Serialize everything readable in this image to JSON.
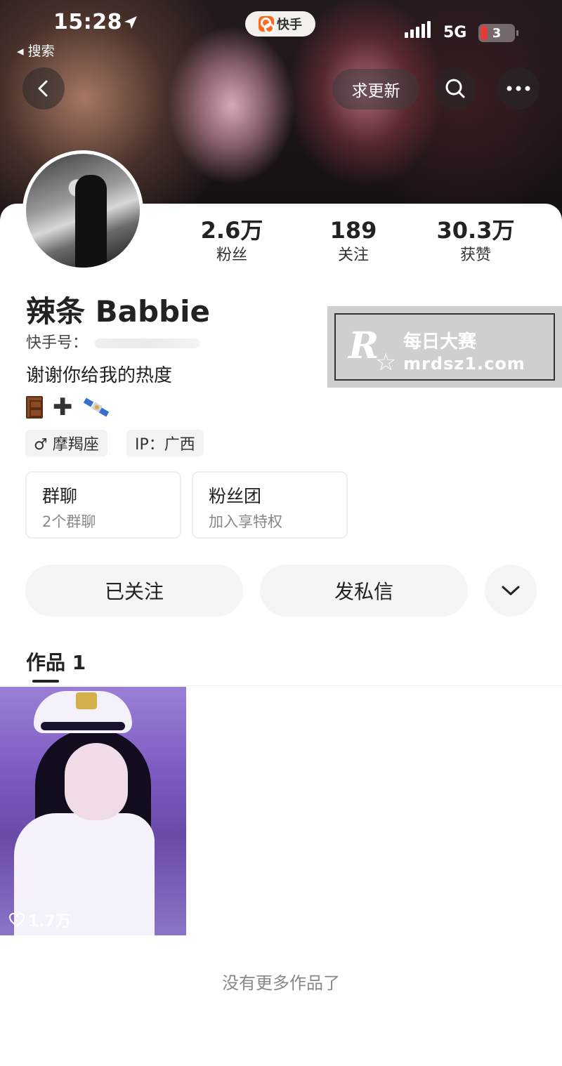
{
  "status_bar": {
    "time": "15:28",
    "back_app": "◂ 搜索",
    "app_name": "快手",
    "network": "5G",
    "battery": "3"
  },
  "header": {
    "update_button": "求更新"
  },
  "profile": {
    "stats": [
      {
        "value": "2.6万",
        "label": "粉丝"
      },
      {
        "value": "189",
        "label": "关注"
      },
      {
        "value": "30.3万",
        "label": "获赞"
      }
    ],
    "name": "辣条 Babbie",
    "kwai_id_label": "快手号：",
    "bio": "谢谢你给我的热度",
    "tags": {
      "zodiac": "♂ 摩羯座",
      "ip": "IP：广西"
    },
    "group_box": {
      "title": "群聊",
      "subtitle": "2个群聊"
    },
    "fans_box": {
      "title": "粉丝团",
      "subtitle": "加入享特权"
    }
  },
  "actions": {
    "follow": "已关注",
    "message": "发私信"
  },
  "works": {
    "tab_label": "作品 1",
    "items": [
      {
        "likes": "1.7万"
      }
    ],
    "end_text": "没有更多作品了"
  },
  "watermark": {
    "logo": "R",
    "title": "每日大赛",
    "url": "mrdsz1.com"
  },
  "colors": {
    "brand": "#ff6a1a",
    "battery_low": "#e53a3a"
  }
}
